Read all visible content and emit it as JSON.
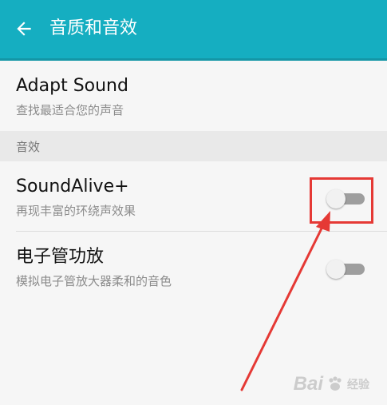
{
  "header": {
    "title": "音质和音效",
    "back_icon": "arrow-left-icon",
    "bg_color": "#15aec1"
  },
  "items": [
    {
      "title": "Adapt Sound",
      "subtitle": "查找最适合您的声音"
    }
  ],
  "section": {
    "label": "音效"
  },
  "effects": [
    {
      "title": "SoundAlive+",
      "subtitle": "再现丰富的环绕声效果",
      "toggle_on": false
    },
    {
      "title": "电子管功放",
      "subtitle": "模拟电子管放大器柔和的音色",
      "toggle_on": false
    }
  ],
  "annotation": {
    "color": "#e53935"
  },
  "watermark": {
    "brand": "Bai",
    "sub": "经验",
    "icon": "baidu-paw-icon"
  }
}
